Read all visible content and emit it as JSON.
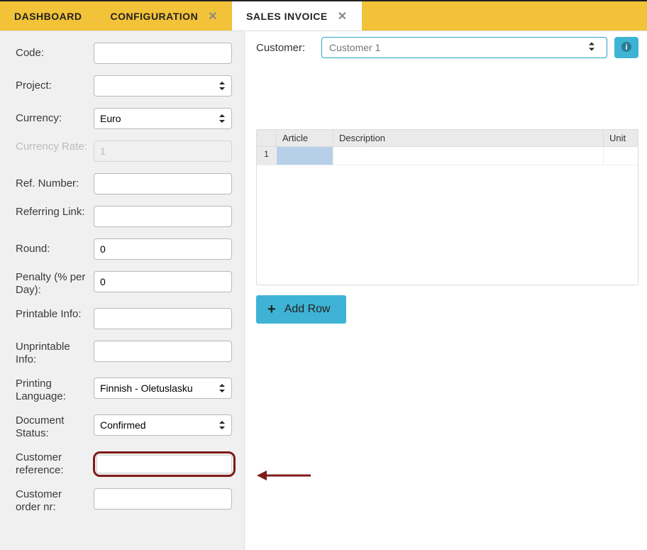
{
  "tabs": [
    {
      "label": "DASHBOARD",
      "closable": false,
      "active": false
    },
    {
      "label": "CONFIGURATION",
      "closable": true,
      "active": false
    },
    {
      "label": "SALES INVOICE",
      "closable": true,
      "active": true
    }
  ],
  "left_form": {
    "code": {
      "label": "Code:",
      "value": ""
    },
    "project": {
      "label": "Project:",
      "value": ""
    },
    "currency": {
      "label": "Currency:",
      "value": "Euro"
    },
    "currency_rate": {
      "label": "Currency Rate:",
      "value": "1"
    },
    "ref_number": {
      "label": "Ref. Number:",
      "value": ""
    },
    "referring_link": {
      "label": "Referring Link:",
      "value": ""
    },
    "round": {
      "label": "Round:",
      "value": "0"
    },
    "penalty": {
      "label": "Penalty (% per Day):",
      "value": "0"
    },
    "printable_info": {
      "label": "Printable Info:",
      "value": ""
    },
    "unprintable_info": {
      "label": "Unprintable Info:",
      "value": ""
    },
    "printing_language": {
      "label": "Printing Language:",
      "value": "Finnish - Oletuslasku"
    },
    "document_status": {
      "label": "Document Status:",
      "value": "Confirmed"
    },
    "customer_reference": {
      "label": "Customer reference:",
      "value": ""
    },
    "customer_order_nr": {
      "label": "Customer order nr:",
      "value": ""
    }
  },
  "right": {
    "customer_label": "Customer:",
    "customer_value": "Customer 1",
    "grid": {
      "headers": {
        "article": "Article",
        "description": "Description",
        "unit": "Unit"
      },
      "rows": [
        {
          "num": "1",
          "article": "",
          "description": "",
          "unit": ""
        }
      ]
    },
    "add_row_label": "Add Row"
  }
}
